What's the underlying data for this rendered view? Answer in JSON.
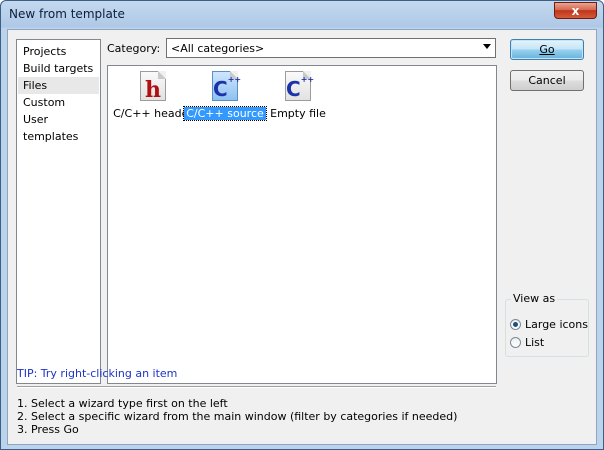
{
  "window": {
    "title": "New from template",
    "close_label": "x"
  },
  "sidebar": {
    "items": [
      {
        "label": "Projects"
      },
      {
        "label": "Build targets"
      },
      {
        "label": "Files"
      },
      {
        "label": "Custom"
      },
      {
        "label": "User templates"
      }
    ],
    "selected": "Files"
  },
  "category": {
    "label": "Category:",
    "value": "<All categories>"
  },
  "templates": [
    {
      "label": "C/C++ header",
      "icon": "c-header-file-icon",
      "glyph": "h",
      "selected": false
    },
    {
      "label": "C/C++ source",
      "icon": "c-source-file-icon",
      "glyph": "C",
      "selected": true
    },
    {
      "label": "Empty file",
      "icon": "empty-file-icon",
      "glyph": "C",
      "selected": false
    }
  ],
  "buttons": {
    "go": "Go",
    "cancel": "Cancel"
  },
  "view_as": {
    "legend": "View as",
    "options": [
      "Large icons",
      "List"
    ],
    "selected": "Large icons"
  },
  "tip": "TIP: Try right-clicking an item",
  "instructions": [
    "1. Select a wizard type first on the left",
    "2. Select a specific wizard from the main window (filter by categories if needed)",
    "3. Press Go"
  ],
  "colors": {
    "tip_text": "#1c33c8",
    "selection": "#3399ff",
    "title_bar": "#c4d9ef"
  }
}
